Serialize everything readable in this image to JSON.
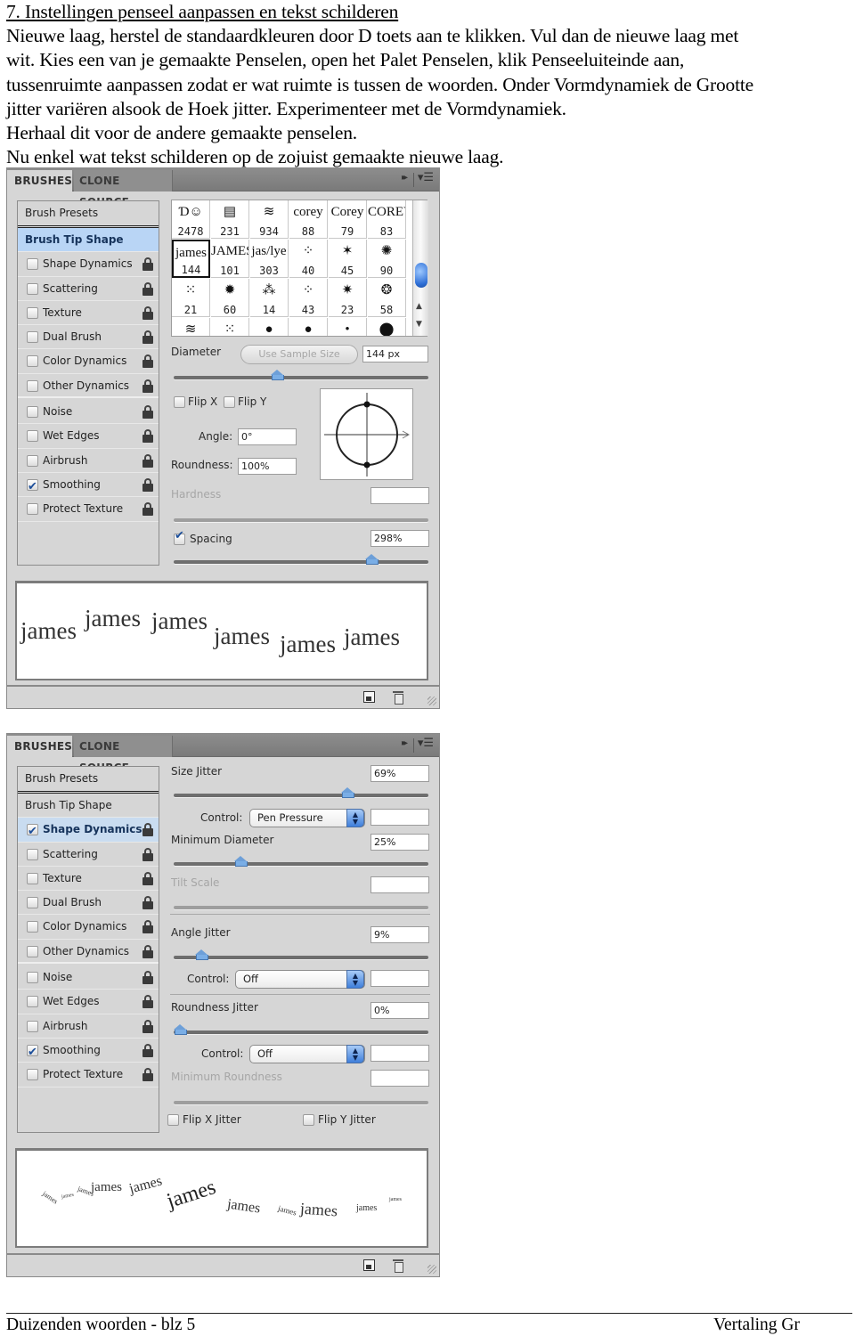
{
  "document": {
    "heading": "7. Instellingen penseel aanpassen en tekst schilderen",
    "paragraph_lines": [
      "Nieuwe laag, herstel de standaardkleuren door D toets aan te klikken. Vul dan de nieuwe laag met",
      "wit. Kies een van je gemaakte Penselen, open het Palet Penselen, klik Penseeluiteinde aan,",
      "tussenruimte aanpassen zodat er wat ruimte is tussen de woorden. Onder Vormdynamiek de Grootte",
      "jitter variëren alsook de Hoek jitter. Experimenteer met de Vormdynamiek.",
      "Herhaal dit voor de andere gemaakte penselen."
    ],
    "last_line": "Nu enkel wat tekst schilderen op de zojuist gemaakte nieuwe laag.",
    "footer_left": "Duizenden woorden - blz 5",
    "footer_right": "Vertaling Gr"
  },
  "panel_common": {
    "tabs": [
      "BRUSHES",
      "CLONE SOURCE"
    ],
    "collapse_glyph": "▸▸",
    "menu_glyph": "▾☰",
    "options": [
      {
        "label": "Brush Presets"
      },
      {
        "label": "Brush Tip Shape"
      },
      {
        "label": "Shape Dynamics"
      },
      {
        "label": "Scattering"
      },
      {
        "label": "Texture"
      },
      {
        "label": "Dual Brush"
      },
      {
        "label": "Color Dynamics"
      },
      {
        "label": "Other Dynamics"
      },
      {
        "label": "Noise"
      },
      {
        "label": "Wet Edges"
      },
      {
        "label": "Airbrush"
      },
      {
        "label": "Smoothing"
      },
      {
        "label": "Protect Texture"
      }
    ]
  },
  "panel1": {
    "selected_option": "Brush Tip Shape",
    "checked_options": [
      "Smoothing"
    ],
    "brush_grid": [
      {
        "glyph": "Ɗ☺",
        "size": "2478"
      },
      {
        "glyph": "▤",
        "size": "231"
      },
      {
        "glyph": "≋",
        "size": "934"
      },
      {
        "glyph": "corey",
        "size": "88"
      },
      {
        "glyph": "Corey",
        "size": "79"
      },
      {
        "glyph": "COREY",
        "size": "83"
      },
      {
        "glyph": "james",
        "size": "144",
        "selected": true
      },
      {
        "glyph": "JAMES",
        "size": "101"
      },
      {
        "glyph": "jas/lye",
        "size": "303"
      },
      {
        "glyph": "⁘",
        "size": "40"
      },
      {
        "glyph": "✶",
        "size": "45"
      },
      {
        "glyph": "✺",
        "size": "90"
      },
      {
        "glyph": "⁙",
        "size": "21"
      },
      {
        "glyph": "✹",
        "size": "60"
      },
      {
        "glyph": "⁂",
        "size": "14"
      },
      {
        "glyph": "⁘",
        "size": "43"
      },
      {
        "glyph": "✷",
        "size": "23"
      },
      {
        "glyph": "❂",
        "size": "58"
      },
      {
        "glyph": "≋",
        "size": ""
      },
      {
        "glyph": "⁙",
        "size": ""
      },
      {
        "glyph": "●",
        "size": ""
      },
      {
        "glyph": "●",
        "size": ""
      },
      {
        "glyph": "•",
        "size": ""
      },
      {
        "glyph": "⬤",
        "size": ""
      }
    ],
    "scroll_up": "▲",
    "scroll_down": "▼",
    "diameter_label": "Diameter",
    "use_sample_size": "Use Sample Size",
    "diameter_value": "144 px",
    "diameter_slider": 0.4,
    "flip_x": "Flip X",
    "flip_y": "Flip Y",
    "angle_label": "Angle:",
    "angle_value": "0°",
    "roundness_label": "Roundness:",
    "roundness_value": "100%",
    "hardness_label": "Hardness",
    "hardness_value": "",
    "spacing_label": "Spacing",
    "spacing_checked": true,
    "spacing_value": "298%",
    "spacing_slider": 0.79,
    "preview_word": "james"
  },
  "panel2": {
    "selected_option": "Shape Dynamics",
    "checked_options": [
      "Shape Dynamics",
      "Smoothing"
    ],
    "size_jitter_label": "Size Jitter",
    "size_jitter_value": "69%",
    "size_jitter_slider": 0.69,
    "control_label": "Control:",
    "size_control": "Pen Pressure",
    "min_diameter_label": "Minimum Diameter",
    "min_diameter_value": "25%",
    "min_diameter_slider": 0.25,
    "tilt_scale_label": "Tilt Scale",
    "angle_jitter_label": "Angle Jitter",
    "angle_jitter_value": "9%",
    "angle_jitter_slider": 0.09,
    "angle_control": "Off",
    "roundness_jitter_label": "Roundness Jitter",
    "roundness_jitter_value": "0%",
    "roundness_jitter_slider": 0.0,
    "roundness_control": "Off",
    "min_roundness_label": "Minimum Roundness",
    "flip_x_jitter": "Flip X Jitter",
    "flip_y_jitter": "Flip Y Jitter",
    "preview_word": "james"
  }
}
